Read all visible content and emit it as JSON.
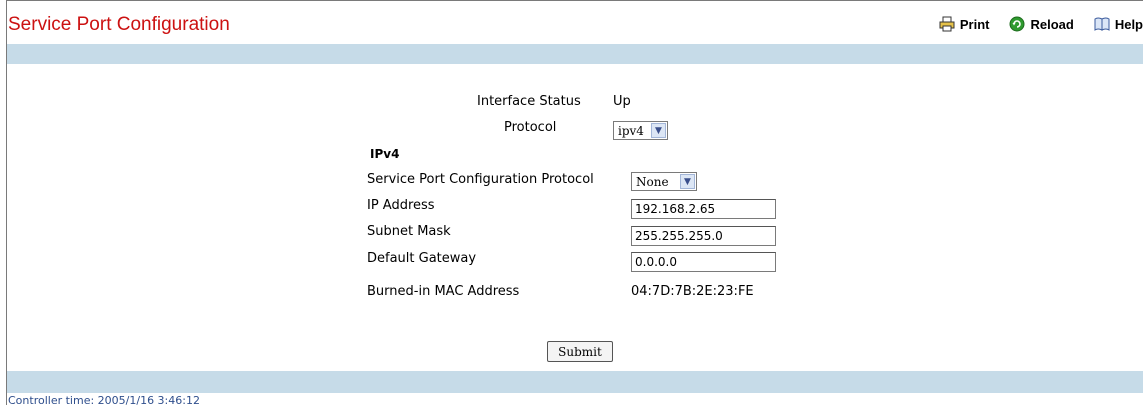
{
  "page": {
    "title": "Service Port Configuration",
    "actions": [
      {
        "label": "Print",
        "icon": "printer-icon"
      },
      {
        "label": "Reload",
        "icon": "reload-icon"
      },
      {
        "label": "Help",
        "icon": "help-book-icon"
      }
    ]
  },
  "form": {
    "interface_status": {
      "label": "Interface Status",
      "value": "Up"
    },
    "protocol": {
      "label": "Protocol",
      "value": "ipv4"
    },
    "section_heading": "IPv4",
    "config_protocol": {
      "label": "Service Port Configuration Protocol",
      "value": "None"
    },
    "ip_address": {
      "label": "IP Address",
      "value": "192.168.2.65"
    },
    "subnet_mask": {
      "label": "Subnet Mask",
      "value": "255.255.255.0"
    },
    "default_gateway": {
      "label": "Default Gateway",
      "value": "0.0.0.0"
    },
    "mac_address": {
      "label": "Burned-in MAC Address",
      "value": "04:7D:7B:2E:23:FE"
    },
    "submit_label": "Submit"
  },
  "footer": {
    "controller_time": "Controller time: 2005/1/16 3:46:12"
  },
  "colors": {
    "title": "#cc1111",
    "band": "#c6dbe8",
    "footer_text": "#2e4e8c"
  }
}
